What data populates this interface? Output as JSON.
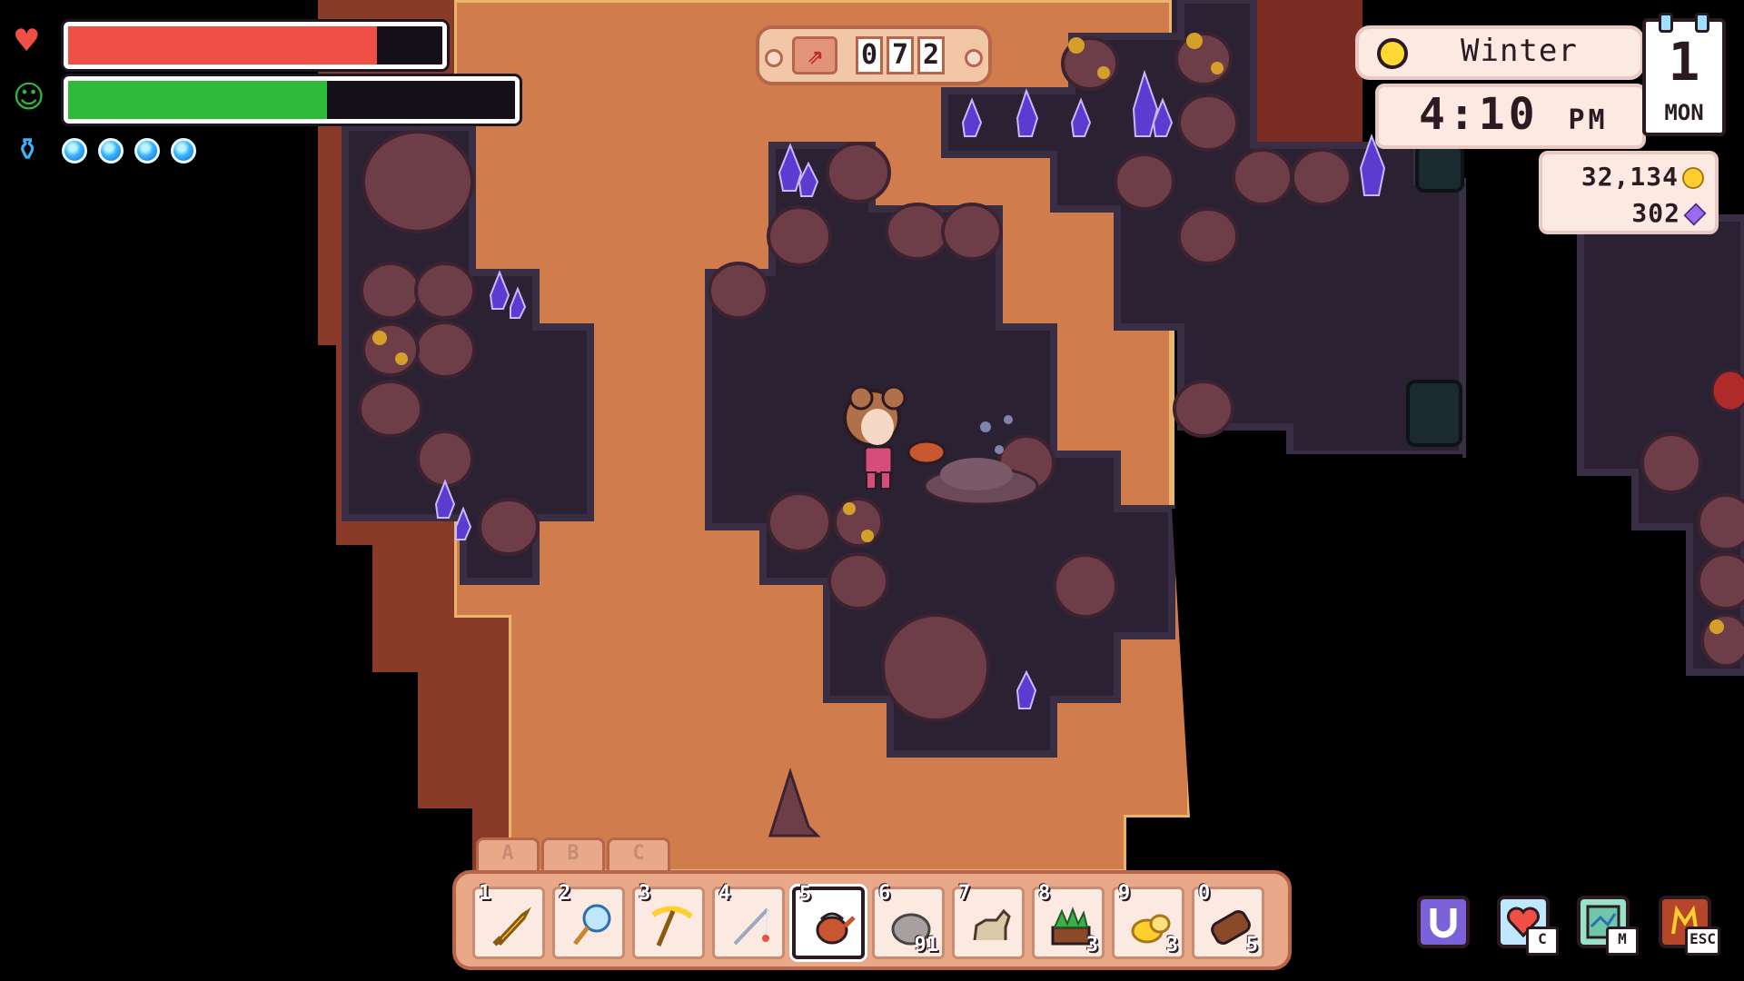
{
  "hud": {
    "health": {
      "icon": "heart-icon",
      "fraction": 0.825,
      "color": "#ef4f45"
    },
    "stamina": {
      "icon": "smiley-stamina-icon",
      "fraction": 0.58,
      "color": "#2fbb3a"
    },
    "mana": {
      "icon": "mana-potion-icon",
      "orbs": 4,
      "color": "#38b6ff"
    }
  },
  "depth": {
    "icon": "mine-depth-icon",
    "digits": [
      "0",
      "7",
      "2"
    ]
  },
  "clock": {
    "season": "Winter",
    "weather_icon": "sun-icon",
    "time": "4:10",
    "ampm": "PM",
    "day": "1",
    "weekday": "MON"
  },
  "currency": {
    "gold": "32,134",
    "gold_icon": "gold-coin-icon",
    "orbs": "302",
    "orbs_icon": "essence-orb-icon"
  },
  "hotbar": {
    "tabs": [
      "A",
      "B",
      "C"
    ],
    "selected_slot": 5,
    "slots": [
      {
        "num": "1",
        "item": "golden-sword-icon",
        "qty": ""
      },
      {
        "num": "2",
        "item": "bug-net-icon",
        "qty": ""
      },
      {
        "num": "3",
        "item": "pickaxe-icon",
        "qty": ""
      },
      {
        "num": "4",
        "item": "fishing-rod-icon",
        "qty": ""
      },
      {
        "num": "5",
        "item": "watering-can-icon",
        "qty": ""
      },
      {
        "num": "6",
        "item": "stone-icon",
        "qty": "91"
      },
      {
        "num": "7",
        "item": "horse-statue-icon",
        "qty": ""
      },
      {
        "num": "8",
        "item": "plant-crate-icon",
        "qty": "3"
      },
      {
        "num": "9",
        "item": "gold-ore-icon",
        "qty": "3"
      },
      {
        "num": "0",
        "item": "wood-log-icon",
        "qty": "5"
      }
    ]
  },
  "menu": [
    {
      "name": "horseshoe-icon",
      "key": ""
    },
    {
      "name": "relationships-icon",
      "key": "C"
    },
    {
      "name": "map-icon",
      "key": "M"
    },
    {
      "name": "journal-menu-icon",
      "key": "ESC"
    }
  ],
  "colors": {
    "dirt_path": "#d07c4d",
    "dirt_edge": "#e9b56a",
    "cave_floor": "#2a2133",
    "cave_wall": "#3a2e44",
    "boulder": "#6e3e48",
    "crystal": "#5b3cd1",
    "ore": "#d4a02a"
  }
}
